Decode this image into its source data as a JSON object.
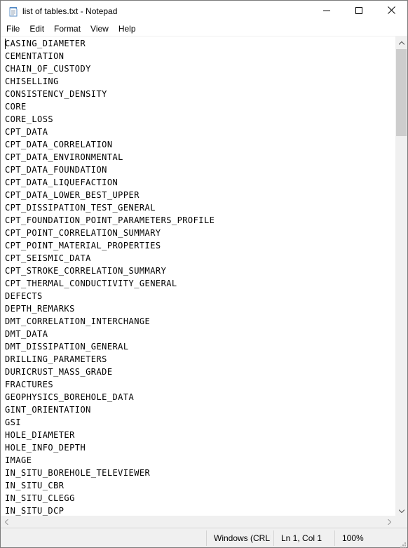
{
  "window": {
    "title": "list of tables.txt - Notepad"
  },
  "menu": [
    "File",
    "Edit",
    "Format",
    "View",
    "Help"
  ],
  "editor": {
    "lines": [
      "CASING_DIAMETER",
      "CEMENTATION",
      "CHAIN_OF_CUSTODY",
      "CHISELLING",
      "CONSISTENCY_DENSITY",
      "CORE",
      "CORE_LOSS",
      "CPT_DATA",
      "CPT_DATA_CORRELATION",
      "CPT_DATA_ENVIRONMENTAL",
      "CPT_DATA_FOUNDATION",
      "CPT_DATA_LIQUEFACTION",
      "CPT_DATA_LOWER_BEST_UPPER",
      "CPT_DISSIPATION_TEST_GENERAL",
      "CPT_FOUNDATION_POINT_PARAMETERS_PROFILE",
      "CPT_POINT_CORRELATION_SUMMARY",
      "CPT_POINT_MATERIAL_PROPERTIES",
      "CPT_SEISMIC_DATA",
      "CPT_STROKE_CORRELATION_SUMMARY",
      "CPT_THERMAL_CONDUCTIVITY_GENERAL",
      "DEFECTS",
      "DEPTH_REMARKS",
      "DMT_CORRELATION_INTERCHANGE",
      "DMT_DATA",
      "DMT_DISSIPATION_GENERAL",
      "DRILLING_PARAMETERS",
      "DURICRUST_MASS_GRADE",
      "FRACTURES",
      "GEOPHYSICS_BOREHOLE_DATA",
      "GINT_ORIENTATION",
      "GSI",
      "HOLE_DIAMETER",
      "HOLE_INFO_DEPTH",
      "IMAGE",
      "IN_SITU_BOREHOLE_TELEVIEWER",
      "IN_SITU_CBR",
      "IN_SITU_CLEGG",
      "IN_SITU_DCP"
    ]
  },
  "status": {
    "line_ending": "Windows (CRLF)",
    "position": "Ln 1, Col 1",
    "zoom": "100%"
  },
  "icons": {
    "app": "notepad-icon",
    "minimize": "minimize-icon",
    "maximize": "maximize-icon",
    "close": "close-icon"
  }
}
